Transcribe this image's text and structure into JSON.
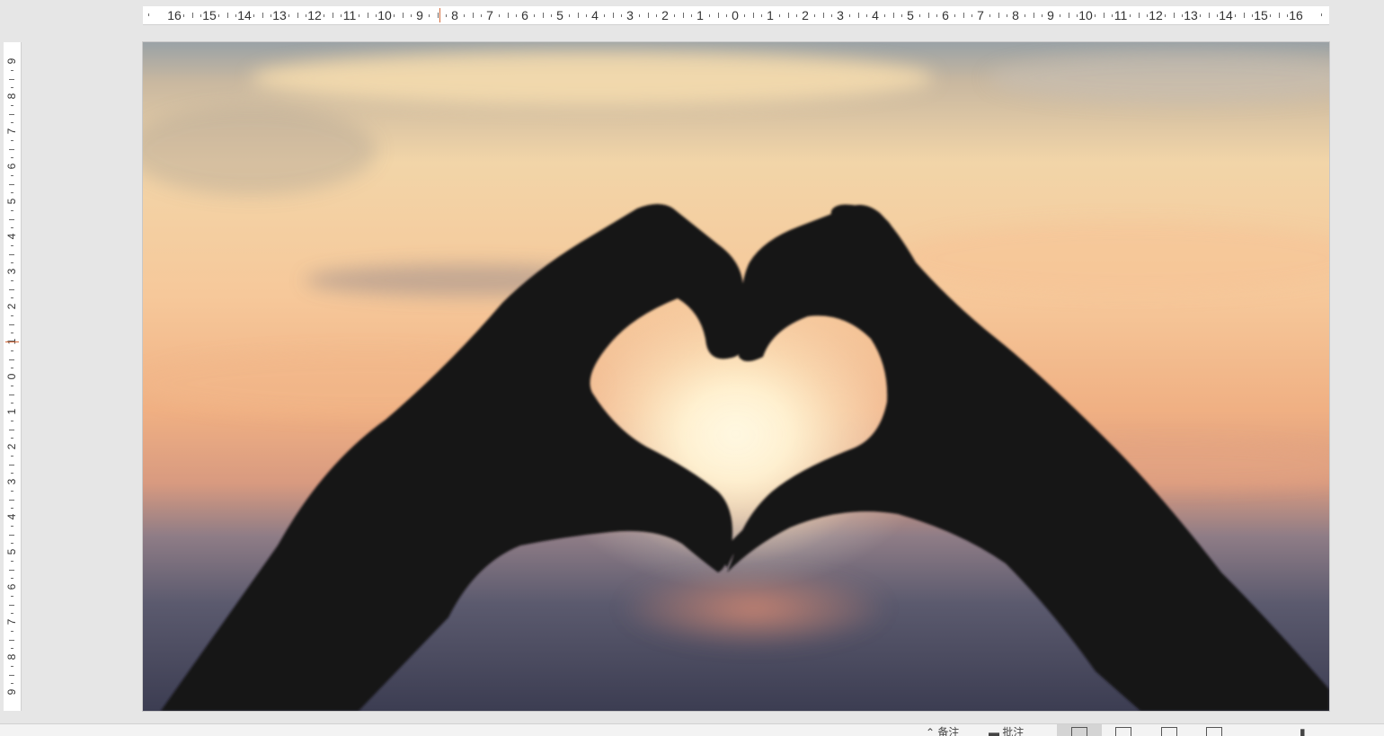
{
  "ruler": {
    "horizontal": {
      "labels": [
        "16",
        "15",
        "14",
        "13",
        "12",
        "11",
        "10",
        "9",
        "8",
        "7",
        "6",
        "5",
        "4",
        "3",
        "2",
        "1",
        "0",
        "1",
        "2",
        "3",
        "4",
        "5",
        "6",
        "7",
        "8",
        "9",
        "10",
        "11",
        "12",
        "13",
        "14",
        "15",
        "16"
      ]
    },
    "vertical": {
      "labels": [
        "9",
        "8",
        "7",
        "6",
        "5",
        "4",
        "3",
        "2",
        "1",
        "0",
        "1",
        "2",
        "3",
        "4",
        "5",
        "6",
        "7",
        "8",
        "9"
      ]
    }
  },
  "slide": {
    "image_description_icon": "heart-hands-sunset-photo"
  },
  "statusbar": {
    "notes_label": "备注",
    "comments_label": "批注",
    "view_normal_icon": "normal-view-icon",
    "view_sorter_icon": "slide-sorter-icon",
    "view_reading_icon": "reading-view-icon",
    "view_slideshow_icon": "slideshow-icon"
  },
  "colors": {
    "workspace": "#e6e6e6",
    "ruler_bg": "#ffffff",
    "marker": "#d46a3a"
  }
}
